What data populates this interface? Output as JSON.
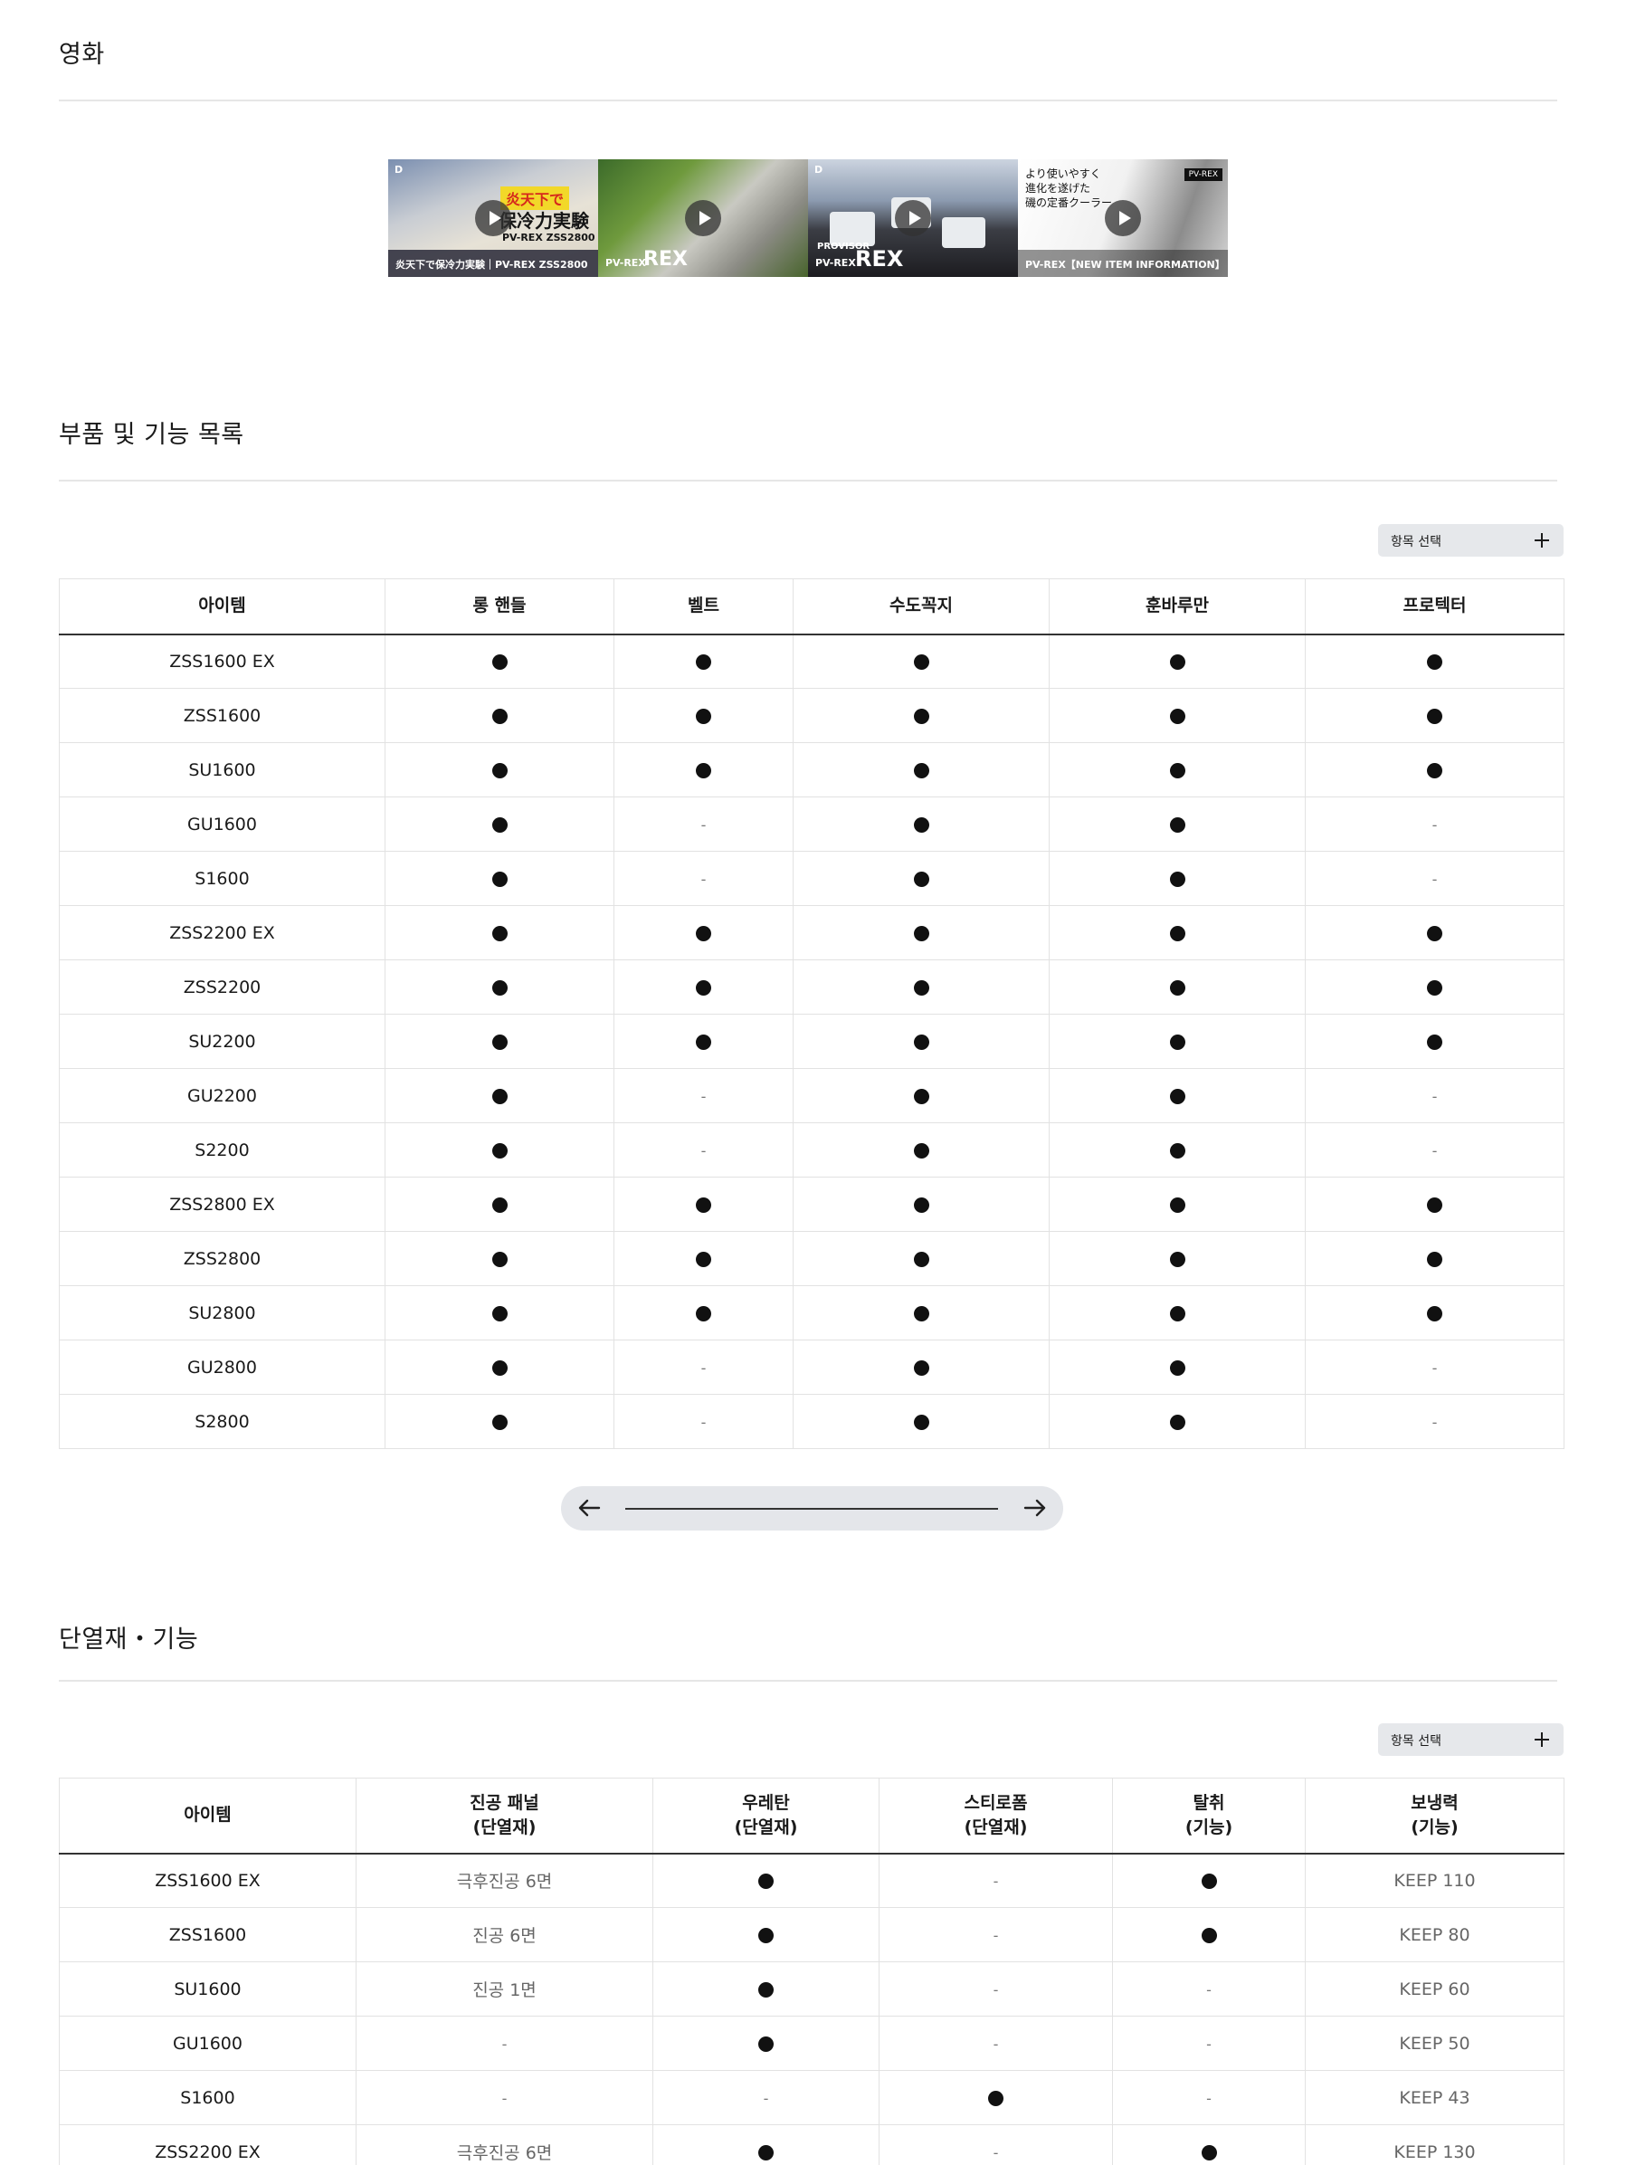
{
  "sections": {
    "video": {
      "title": "영화"
    },
    "parts": {
      "title": "부품 및 기능 목록"
    },
    "insulation": {
      "title": "단열재・기능"
    }
  },
  "videos": [
    {
      "logo": "D",
      "tag": "炎天下で",
      "headline": "保冷力実験",
      "model": "PV-REX ZSS2800",
      "caption": "炎天下で保冷力実験｜PV-REX ZSS2800",
      "icon": "play-icon"
    },
    {
      "headline": "REX",
      "caption": "PV-REX",
      "icon": "play-icon"
    },
    {
      "logo": "D",
      "small": "PROVISOR",
      "headline": "REX",
      "caption": "PV-REX",
      "icon": "play-icon"
    },
    {
      "jp": "より使いやすく\n進化を遂げた\n磯の定番クーラー",
      "badge": "PV-REX",
      "caption": "PV-REX【NEW ITEM INFORMATION】",
      "icon": "play-icon"
    }
  ],
  "select_button": {
    "label": "항목 선택",
    "icon": "plus-icon"
  },
  "parts_table": {
    "headers": [
      "아이템",
      "롱 핸들",
      "벨트",
      "수도꼭지",
      "훈바루만",
      "프로텍터"
    ],
    "rows": [
      [
        "ZSS1600 EX",
        "●",
        "●",
        "●",
        "●",
        "●"
      ],
      [
        "ZSS1600",
        "●",
        "●",
        "●",
        "●",
        "●"
      ],
      [
        "SU1600",
        "●",
        "●",
        "●",
        "●",
        "●"
      ],
      [
        "GU1600",
        "●",
        "-",
        "●",
        "●",
        "-"
      ],
      [
        "S1600",
        "●",
        "-",
        "●",
        "●",
        "-"
      ],
      [
        "ZSS2200 EX",
        "●",
        "●",
        "●",
        "●",
        "●"
      ],
      [
        "ZSS2200",
        "●",
        "●",
        "●",
        "●",
        "●"
      ],
      [
        "SU2200",
        "●",
        "●",
        "●",
        "●",
        "●"
      ],
      [
        "GU2200",
        "●",
        "-",
        "●",
        "●",
        "-"
      ],
      [
        "S2200",
        "●",
        "-",
        "●",
        "●",
        "-"
      ],
      [
        "ZSS2800 EX",
        "●",
        "●",
        "●",
        "●",
        "●"
      ],
      [
        "ZSS2800",
        "●",
        "●",
        "●",
        "●",
        "●"
      ],
      [
        "SU2800",
        "●",
        "●",
        "●",
        "●",
        "●"
      ],
      [
        "GU2800",
        "●",
        "-",
        "●",
        "●",
        "-"
      ],
      [
        "S2800",
        "●",
        "-",
        "●",
        "●",
        "-"
      ]
    ]
  },
  "scroller": {
    "left_icon": "arrow-left-icon",
    "right_icon": "arrow-right-icon"
  },
  "insulation_table": {
    "headers": [
      [
        "아이템"
      ],
      [
        "진공 패널",
        "(단열재)"
      ],
      [
        "우레탄",
        "(단열재)"
      ],
      [
        "스티로폼",
        "(단열재)"
      ],
      [
        "탈취",
        "(기능)"
      ],
      [
        "보냉력",
        "(기능)"
      ]
    ],
    "rows": [
      [
        "ZSS1600 EX",
        "극후진공 6면",
        "●",
        "-",
        "●",
        "KEEP 110"
      ],
      [
        "ZSS1600",
        "진공 6면",
        "●",
        "-",
        "●",
        "KEEP 80"
      ],
      [
        "SU1600",
        "진공 1면",
        "●",
        "-",
        "-",
        "KEEP 60"
      ],
      [
        "GU1600",
        "-",
        "●",
        "-",
        "-",
        "KEEP 50"
      ],
      [
        "S1600",
        "-",
        "-",
        "●",
        "-",
        "KEEP 43"
      ],
      [
        "ZSS2200 EX",
        "극후진공 6면",
        "●",
        "-",
        "●",
        "KEEP 130"
      ]
    ]
  }
}
